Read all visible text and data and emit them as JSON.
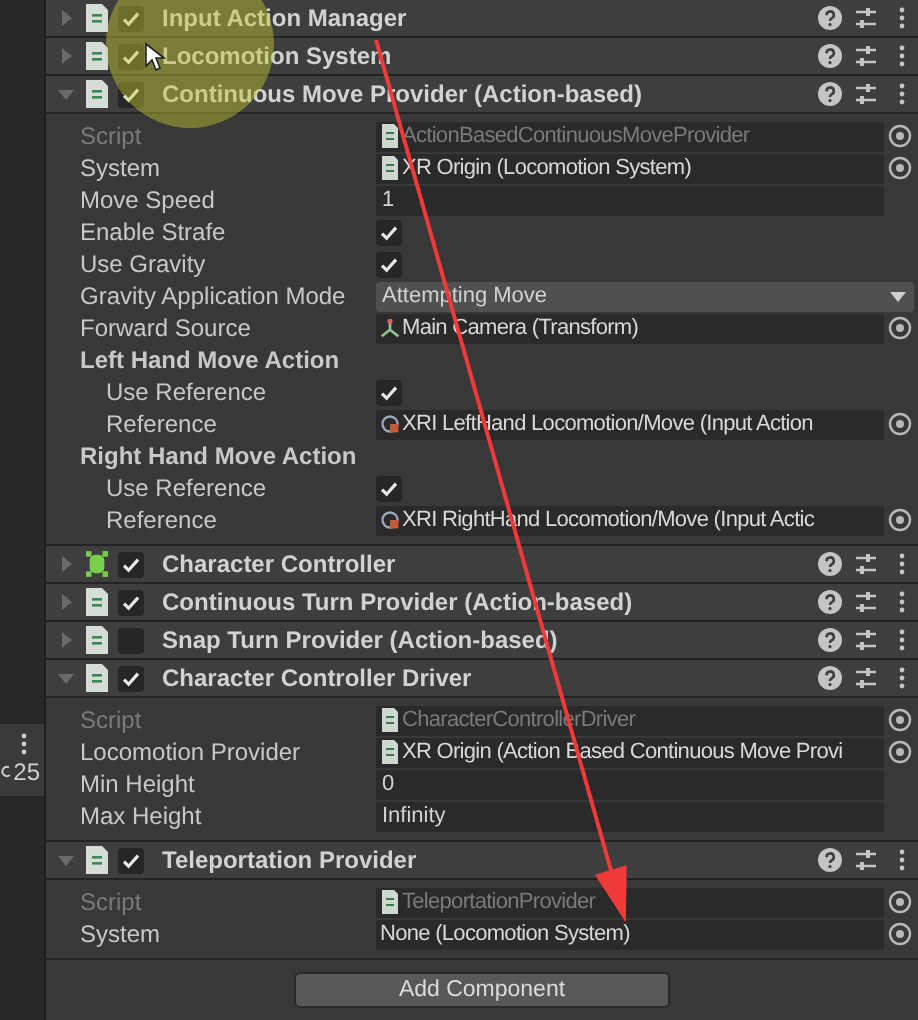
{
  "left_panel": {
    "count": "25"
  },
  "components": [
    {
      "title": "Input Action Manager",
      "kind": "script",
      "enabled": true,
      "expanded": false
    },
    {
      "title": "Locomotion System",
      "kind": "script",
      "enabled": true,
      "expanded": false
    },
    {
      "title": "Continuous Move Provider (Action-based)",
      "kind": "script",
      "enabled": true,
      "expanded": true,
      "fields": [
        {
          "kind": "script_ref",
          "label": "Script",
          "value": "ActionBasedContinuousMoveProvider",
          "disabled": true
        },
        {
          "kind": "script_ref",
          "label": "System",
          "value": "XR Origin (Locomotion System)",
          "disabled": false
        },
        {
          "kind": "text",
          "label": "Move Speed",
          "value": "1",
          "disabled": false
        },
        {
          "kind": "checkbox",
          "label": "Enable Strafe",
          "checked": true,
          "disabled": false
        },
        {
          "kind": "checkbox",
          "label": "Use Gravity",
          "checked": true,
          "disabled": false
        },
        {
          "kind": "dropdown",
          "label": "Gravity Application Mode",
          "value": "Attempting Move",
          "disabled": false
        },
        {
          "kind": "transform_ref",
          "label": "Forward Source",
          "value": "Main Camera (Transform)",
          "disabled": false
        },
        {
          "kind": "group",
          "label": "Left Hand Move Action",
          "disabled": false,
          "children": [
            {
              "kind": "checkbox",
              "label": "Use Reference",
              "checked": true,
              "disabled": false
            },
            {
              "kind": "action_ref",
              "label": "Reference",
              "value": "XRI LeftHand Locomotion/Move (Input Action",
              "disabled": false
            }
          ]
        },
        {
          "kind": "group",
          "label": "Right Hand Move Action",
          "disabled": false,
          "children": [
            {
              "kind": "checkbox",
              "label": "Use Reference",
              "checked": true,
              "disabled": false
            },
            {
              "kind": "action_ref",
              "label": "Reference",
              "value": "XRI RightHand Locomotion/Move (Input Actic",
              "disabled": false
            }
          ]
        }
      ]
    },
    {
      "title": "Character Controller",
      "kind": "controller",
      "enabled": true,
      "expanded": false
    },
    {
      "title": "Continuous Turn Provider (Action-based)",
      "kind": "script",
      "enabled": true,
      "expanded": false
    },
    {
      "title": "Snap Turn Provider (Action-based)",
      "kind": "script",
      "enabled": false,
      "expanded": false
    },
    {
      "title": "Character Controller Driver",
      "kind": "script",
      "enabled": true,
      "expanded": true,
      "fields": [
        {
          "kind": "script_ref",
          "label": "Script",
          "value": "CharacterControllerDriver",
          "disabled": true
        },
        {
          "kind": "script_ref",
          "label": "Locomotion Provider",
          "value": "XR Origin (Action Based Continuous Move Provi",
          "disabled": false
        },
        {
          "kind": "text",
          "label": "Min Height",
          "value": "0",
          "disabled": false
        },
        {
          "kind": "text",
          "label": "Max Height",
          "value": "Infinity",
          "disabled": false
        }
      ]
    },
    {
      "title": "Teleportation Provider",
      "kind": "script",
      "enabled": true,
      "expanded": true,
      "fields": [
        {
          "kind": "script_ref",
          "label": "Script",
          "value": "TeleportationProvider",
          "disabled": true
        },
        {
          "kind": "ref",
          "label": "System",
          "value": "None (Locomotion System)",
          "disabled": false
        }
      ]
    }
  ],
  "add_button": "Add Component"
}
